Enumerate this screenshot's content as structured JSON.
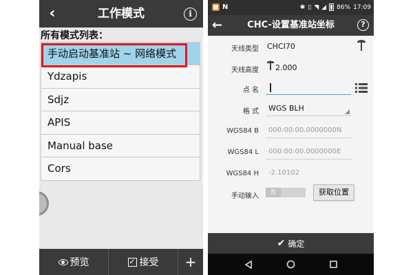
{
  "left_screen": {
    "title": "工作模式",
    "back_icon": "‹",
    "info_icon": "i",
    "list_heading": "所有模式列表：",
    "modes": [
      {
        "label": "手动启动基准站 ~ 网络模式",
        "selected": true
      },
      {
        "label": "Ydzapis",
        "selected": false
      },
      {
        "label": "Sdjz",
        "selected": false
      },
      {
        "label": "APIS",
        "selected": false
      },
      {
        "label": "Manual base",
        "selected": false
      },
      {
        "label": "Cors",
        "selected": false
      }
    ],
    "footer": {
      "preview_label": "预览",
      "accept_label": "接受",
      "add_label": "+"
    },
    "colors": {
      "header": "#3a3a3a",
      "selected_row": "#9fd4ec",
      "highlight_box": "#e8141b"
    }
  },
  "right_screen": {
    "status_bar": {
      "n_icon": "N",
      "battery": "86%",
      "time": "17:09"
    },
    "title": "CHC-设置基准站坐标",
    "back_icon": "←",
    "help_icon": "?",
    "fields": {
      "antenna_type_label": "天线类型",
      "antenna_type_value": "CHCI70",
      "antenna_height_label": "天线高度",
      "antenna_height_value": "2.000",
      "point_name_label": "点  名",
      "point_name_value": "",
      "format_label": "格  式",
      "format_value": "WGS BLH",
      "wgs84_b_label": "WGS84 B",
      "wgs84_b_placeholder": "000:00:00.0000000N",
      "wgs84_l_label": "WGS84 L",
      "wgs84_l_placeholder": "000:00:00.0000000E",
      "wgs84_h_label": "WGS84 H",
      "wgs84_h_placeholder": "-2.10102",
      "manual_input_label": "手动输入",
      "manual_toggle_text": "否"
    },
    "get_position_label": "获取位置",
    "confirm_label": "确定",
    "colors": {
      "header": "#3a3a3a",
      "active_underline": "#4aa3c4"
    }
  }
}
